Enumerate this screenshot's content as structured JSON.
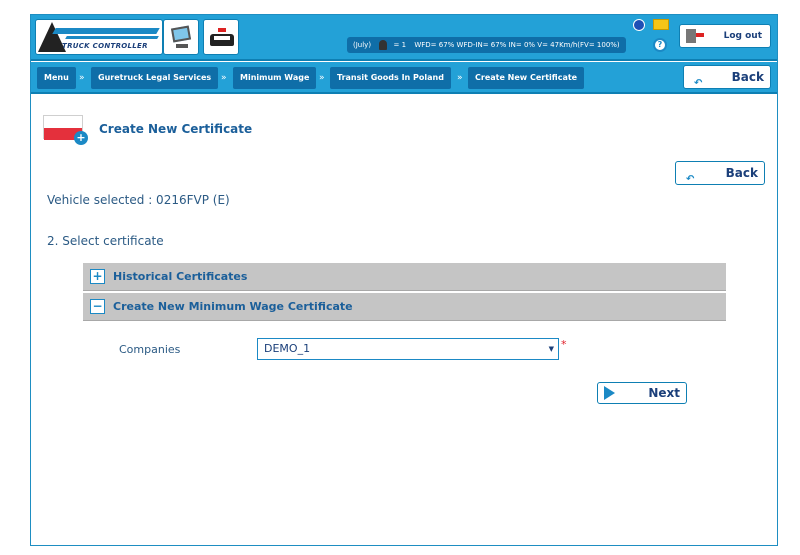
{
  "header": {
    "logo_text": "TRUCK CONTROLLER",
    "status_month": "(July)",
    "status_driver_count": "= 1",
    "status_stats": "WFD= 67%   WFD-IN= 67%   IN= 0%   V= 47Km/h(FV= 100%)",
    "logout_label": "Log out"
  },
  "breadcrumb": {
    "items": [
      "Menu",
      "Guretruck Legal Services",
      "Minimum Wage",
      "Transit Goods In Poland",
      "Create New Certificate"
    ],
    "separator": "»",
    "back_label": "Back"
  },
  "main": {
    "title": "Create New Certificate",
    "back_label": "Back",
    "vehicle_text": "Vehicle selected : 0216FVP (E)",
    "step_text": "2. Select certificate",
    "panels": [
      {
        "label": "Historical Certificates",
        "toggle": "+"
      },
      {
        "label": "Create New Minimum Wage Certificate",
        "toggle": "−"
      }
    ],
    "companies_label": "Companies",
    "companies_value": "DEMO_1",
    "required_mark": "*",
    "next_label": "Next"
  },
  "colors": {
    "header_blue": "#23a1d7",
    "crumb_blue": "#0f6ea8",
    "panel_gray": "#c5c5c5",
    "text_blue": "#1b5f9a"
  },
  "icons": [
    "truck-controller-logo",
    "computer-icon",
    "police-car-icon",
    "driver-icon",
    "info-icon",
    "mail-icon",
    "help-icon",
    "logout-door-icon",
    "back-arrow-icon",
    "poland-flag-icon",
    "plus-icon",
    "minus-icon",
    "next-arrow-icon"
  ]
}
